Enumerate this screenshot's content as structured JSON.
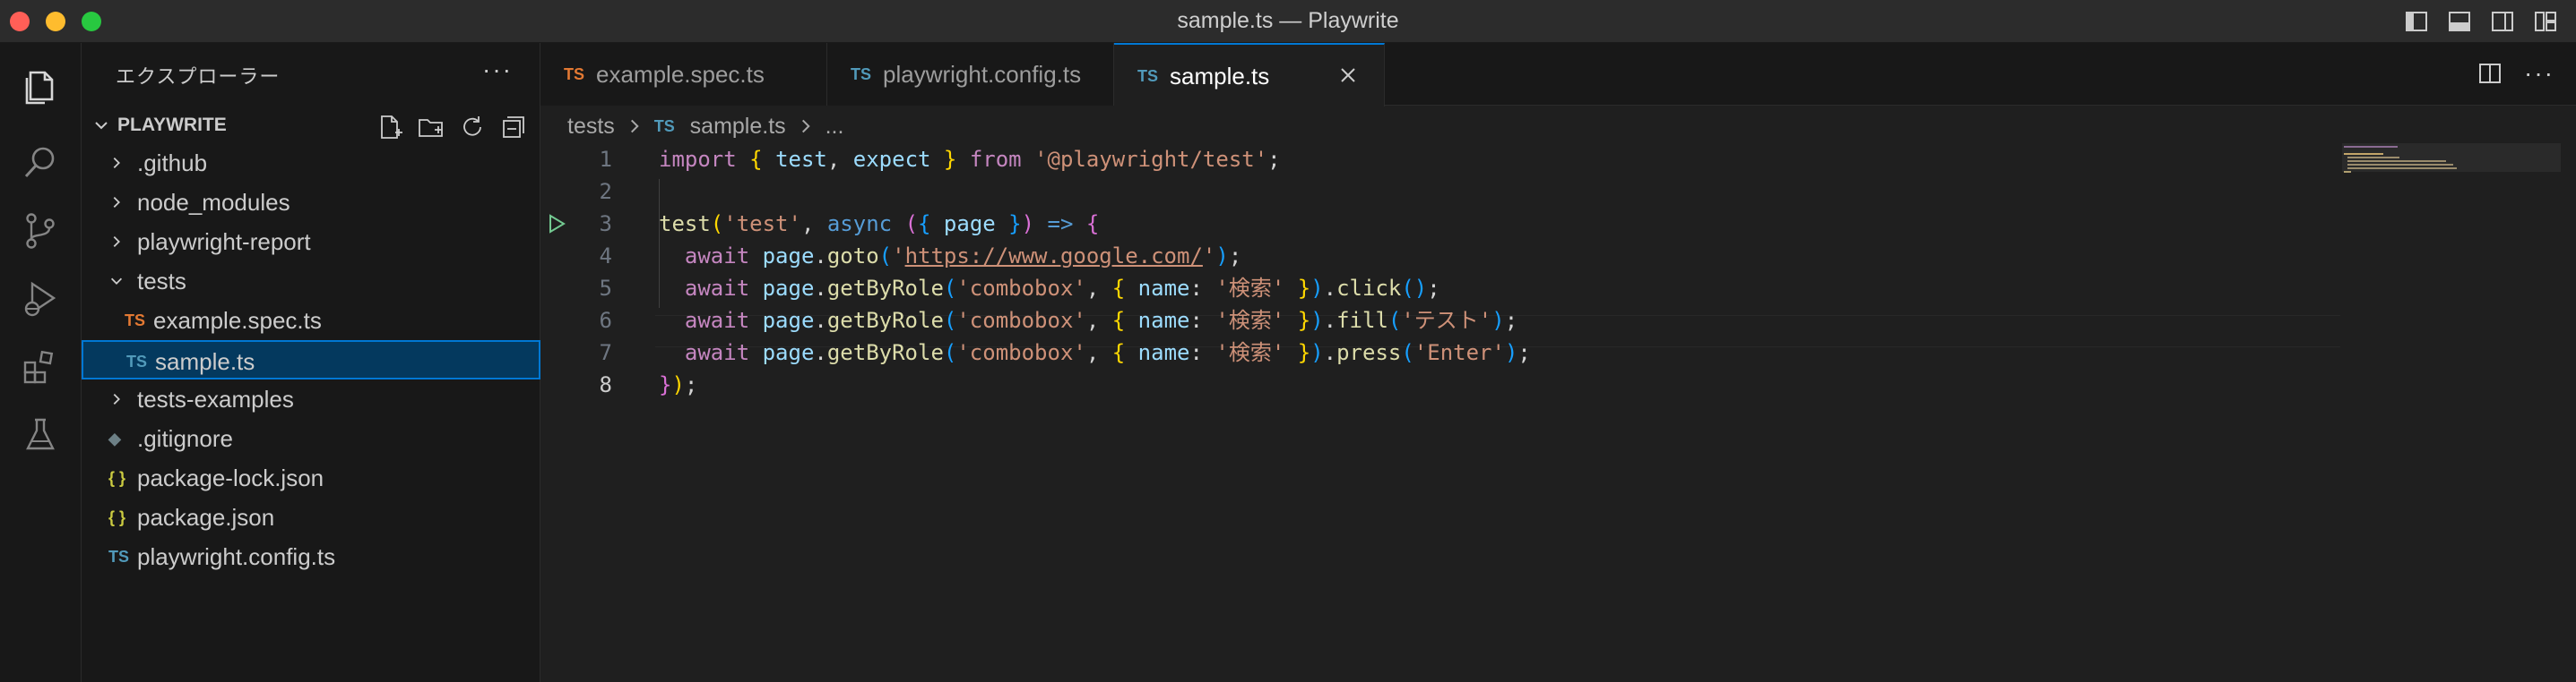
{
  "window": {
    "title": "sample.ts — Playwrite"
  },
  "colors": {
    "accent": "#0078d4",
    "ts_icon": "#519aba",
    "ts_test_icon": "#e37933",
    "json_icon": "#cbcb41",
    "git_icon": "#6d8086"
  },
  "activity_bar": [
    {
      "name": "explorer-icon",
      "active": true
    },
    {
      "name": "search-icon"
    },
    {
      "name": "source-control-icon"
    },
    {
      "name": "run-debug-icon"
    },
    {
      "name": "extensions-icon"
    },
    {
      "name": "testing-icon"
    }
  ],
  "sidebar": {
    "title": "エクスプローラー",
    "more": "···",
    "section": "PLAYWRITE",
    "tree": [
      {
        "label": ".github",
        "type": "folder",
        "expanded": false,
        "depth": 0
      },
      {
        "label": "node_modules",
        "type": "folder",
        "expanded": false,
        "depth": 0
      },
      {
        "label": "playwright-report",
        "type": "folder",
        "expanded": false,
        "depth": 0
      },
      {
        "label": "tests",
        "type": "folder",
        "expanded": true,
        "depth": 0
      },
      {
        "label": "example.spec.ts",
        "type": "ts-test",
        "icon": "TS",
        "depth": 1
      },
      {
        "label": "sample.ts",
        "type": "ts",
        "icon": "TS",
        "depth": 1,
        "selected": true
      },
      {
        "label": "tests-examples",
        "type": "folder",
        "expanded": false,
        "depth": 0
      },
      {
        "label": ".gitignore",
        "type": "git",
        "icon": "◆",
        "depth": 0
      },
      {
        "label": "package-lock.json",
        "type": "json",
        "icon": "{ }",
        "depth": 0
      },
      {
        "label": "package.json",
        "type": "json",
        "icon": "{ }",
        "depth": 0
      },
      {
        "label": "playwright.config.ts",
        "type": "ts",
        "icon": "TS",
        "depth": 0
      }
    ]
  },
  "tabs": [
    {
      "label": "example.spec.ts",
      "icon": "TS",
      "kind": "ts-test"
    },
    {
      "label": "playwright.config.ts",
      "icon": "TS",
      "kind": "ts"
    },
    {
      "label": "sample.ts",
      "icon": "TS",
      "kind": "ts",
      "active": true
    }
  ],
  "editor_actions": {
    "more": "···"
  },
  "breadcrumb": {
    "folder": "tests",
    "file_icon": "TS",
    "file": "sample.ts",
    "symbol": "..."
  },
  "code": {
    "current_line": 8,
    "lines": [
      {
        "n": "1",
        "tokens": [
          [
            "kw",
            "import"
          ],
          [
            "plain",
            " "
          ],
          [
            "b1",
            "{"
          ],
          [
            "plain",
            " "
          ],
          [
            "var",
            "test"
          ],
          [
            "plain",
            ", "
          ],
          [
            "var",
            "expect"
          ],
          [
            "plain",
            " "
          ],
          [
            "b1",
            "}"
          ],
          [
            "plain",
            " "
          ],
          [
            "kw",
            "from"
          ],
          [
            "plain",
            " "
          ],
          [
            "str",
            "'@playwright/test'"
          ],
          [
            "plain",
            ";"
          ]
        ]
      },
      {
        "n": "2",
        "tokens": []
      },
      {
        "n": "3",
        "run": true,
        "tokens": [
          [
            "fn",
            "test"
          ],
          [
            "b1",
            "("
          ],
          [
            "str",
            "'test'"
          ],
          [
            "plain",
            ", "
          ],
          [
            "kw2",
            "async"
          ],
          [
            "plain",
            " "
          ],
          [
            "b2",
            "("
          ],
          [
            "b3",
            "{"
          ],
          [
            "plain",
            " "
          ],
          [
            "var",
            "page"
          ],
          [
            "plain",
            " "
          ],
          [
            "b3",
            "}"
          ],
          [
            "b2",
            ")"
          ],
          [
            "plain",
            " "
          ],
          [
            "kw2",
            "=>"
          ],
          [
            "plain",
            " "
          ],
          [
            "b2",
            "{"
          ]
        ]
      },
      {
        "n": "4",
        "tokens": [
          [
            "plain",
            "  "
          ],
          [
            "kw",
            "await"
          ],
          [
            "plain",
            " "
          ],
          [
            "var",
            "page"
          ],
          [
            "plain",
            "."
          ],
          [
            "fn",
            "goto"
          ],
          [
            "b3",
            "("
          ],
          [
            "str",
            "'"
          ],
          [
            "url",
            "https://www.google.com/"
          ],
          [
            "str",
            "'"
          ],
          [
            "b3",
            ")"
          ],
          [
            "plain",
            ";"
          ]
        ]
      },
      {
        "n": "5",
        "tokens": [
          [
            "plain",
            "  "
          ],
          [
            "kw",
            "await"
          ],
          [
            "plain",
            " "
          ],
          [
            "var",
            "page"
          ],
          [
            "plain",
            "."
          ],
          [
            "fn",
            "getByRole"
          ],
          [
            "b3",
            "("
          ],
          [
            "str",
            "'combobox'"
          ],
          [
            "plain",
            ", "
          ],
          [
            "b1",
            "{"
          ],
          [
            "plain",
            " "
          ],
          [
            "var",
            "name"
          ],
          [
            "plain",
            ": "
          ],
          [
            "str",
            "'検索'"
          ],
          [
            "plain",
            " "
          ],
          [
            "b1",
            "}"
          ],
          [
            "b3",
            ")"
          ],
          [
            "plain",
            "."
          ],
          [
            "fn",
            "click"
          ],
          [
            "b3",
            "()"
          ],
          [
            "plain",
            ";"
          ]
        ]
      },
      {
        "n": "6",
        "tokens": [
          [
            "plain",
            "  "
          ],
          [
            "kw",
            "await"
          ],
          [
            "plain",
            " "
          ],
          [
            "var",
            "page"
          ],
          [
            "plain",
            "."
          ],
          [
            "fn",
            "getByRole"
          ],
          [
            "b3",
            "("
          ],
          [
            "str",
            "'combobox'"
          ],
          [
            "plain",
            ", "
          ],
          [
            "b1",
            "{"
          ],
          [
            "plain",
            " "
          ],
          [
            "var",
            "name"
          ],
          [
            "plain",
            ": "
          ],
          [
            "str",
            "'検索'"
          ],
          [
            "plain",
            " "
          ],
          [
            "b1",
            "}"
          ],
          [
            "b3",
            ")"
          ],
          [
            "plain",
            "."
          ],
          [
            "fn",
            "fill"
          ],
          [
            "b3",
            "("
          ],
          [
            "str",
            "'テスト'"
          ],
          [
            "b3",
            ")"
          ],
          [
            "plain",
            ";"
          ]
        ]
      },
      {
        "n": "7",
        "tokens": [
          [
            "plain",
            "  "
          ],
          [
            "kw",
            "await"
          ],
          [
            "plain",
            " "
          ],
          [
            "var",
            "page"
          ],
          [
            "plain",
            "."
          ],
          [
            "fn",
            "getByRole"
          ],
          [
            "b3",
            "("
          ],
          [
            "str",
            "'combobox'"
          ],
          [
            "plain",
            ", "
          ],
          [
            "b1",
            "{"
          ],
          [
            "plain",
            " "
          ],
          [
            "var",
            "name"
          ],
          [
            "plain",
            ": "
          ],
          [
            "str",
            "'検索'"
          ],
          [
            "plain",
            " "
          ],
          [
            "b1",
            "}"
          ],
          [
            "b3",
            ")"
          ],
          [
            "plain",
            "."
          ],
          [
            "fn",
            "press"
          ],
          [
            "b3",
            "("
          ],
          [
            "str",
            "'Enter'"
          ],
          [
            "b3",
            ")"
          ],
          [
            "plain",
            ";"
          ]
        ]
      },
      {
        "n": "8",
        "tokens": [
          [
            "b2",
            "}"
          ],
          [
            "b1",
            ")"
          ],
          [
            "plain",
            ";"
          ]
        ]
      }
    ]
  }
}
